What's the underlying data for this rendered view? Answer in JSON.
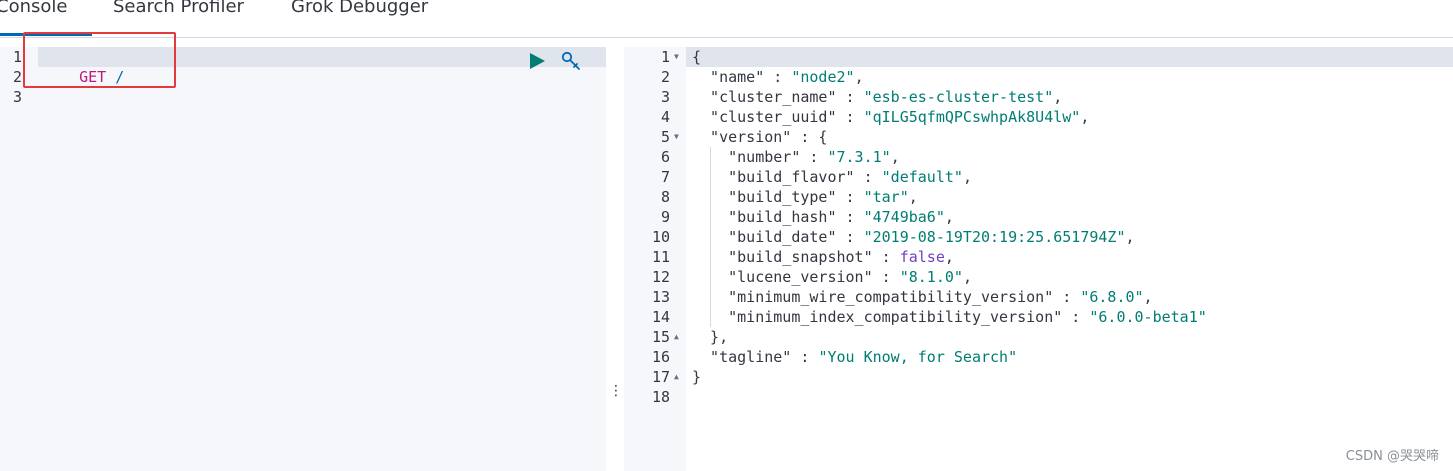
{
  "tabs": [
    {
      "label": "Console"
    },
    {
      "label": "Search Profiler"
    },
    {
      "label": "Grok Debugger"
    }
  ],
  "request_editor": {
    "line_numbers": [
      "1",
      "2",
      "3"
    ],
    "method": "GET",
    "path": "/"
  },
  "response": {
    "line_numbers": [
      "1",
      "2",
      "3",
      "4",
      "5",
      "6",
      "7",
      "8",
      "9",
      "10",
      "11",
      "12",
      "13",
      "14",
      "15",
      "16",
      "17",
      "18"
    ],
    "lines": [
      [
        {
          "c": "punc",
          "t": "{"
        }
      ],
      [
        {
          "c": "key",
          "t": "  \"name\""
        },
        {
          "c": "punc",
          "t": " : "
        },
        {
          "c": "str",
          "t": "\"node2\""
        },
        {
          "c": "punc",
          "t": ","
        }
      ],
      [
        {
          "c": "key",
          "t": "  \"cluster_name\""
        },
        {
          "c": "punc",
          "t": " : "
        },
        {
          "c": "str",
          "t": "\"esb-es-cluster-test\""
        },
        {
          "c": "punc",
          "t": ","
        }
      ],
      [
        {
          "c": "key",
          "t": "  \"cluster_uuid\""
        },
        {
          "c": "punc",
          "t": " : "
        },
        {
          "c": "str",
          "t": "\"qILG5qfmQPCswhpAk8U4lw\""
        },
        {
          "c": "punc",
          "t": ","
        }
      ],
      [
        {
          "c": "key",
          "t": "  \"version\""
        },
        {
          "c": "punc",
          "t": " : {"
        }
      ],
      [
        {
          "c": "key",
          "t": "    \"number\""
        },
        {
          "c": "punc",
          "t": " : "
        },
        {
          "c": "str",
          "t": "\"7.3.1\""
        },
        {
          "c": "punc",
          "t": ","
        }
      ],
      [
        {
          "c": "key",
          "t": "    \"build_flavor\""
        },
        {
          "c": "punc",
          "t": " : "
        },
        {
          "c": "str",
          "t": "\"default\""
        },
        {
          "c": "punc",
          "t": ","
        }
      ],
      [
        {
          "c": "key",
          "t": "    \"build_type\""
        },
        {
          "c": "punc",
          "t": " : "
        },
        {
          "c": "str",
          "t": "\"tar\""
        },
        {
          "c": "punc",
          "t": ","
        }
      ],
      [
        {
          "c": "key",
          "t": "    \"build_hash\""
        },
        {
          "c": "punc",
          "t": " : "
        },
        {
          "c": "str",
          "t": "\"4749ba6\""
        },
        {
          "c": "punc",
          "t": ","
        }
      ],
      [
        {
          "c": "key",
          "t": "    \"build_date\""
        },
        {
          "c": "punc",
          "t": " : "
        },
        {
          "c": "str",
          "t": "\"2019-08-19T20:19:25.651794Z\""
        },
        {
          "c": "punc",
          "t": ","
        }
      ],
      [
        {
          "c": "key",
          "t": "    \"build_snapshot\""
        },
        {
          "c": "punc",
          "t": " : "
        },
        {
          "c": "bool",
          "t": "false"
        },
        {
          "c": "punc",
          "t": ","
        }
      ],
      [
        {
          "c": "key",
          "t": "    \"lucene_version\""
        },
        {
          "c": "punc",
          "t": " : "
        },
        {
          "c": "str",
          "t": "\"8.1.0\""
        },
        {
          "c": "punc",
          "t": ","
        }
      ],
      [
        {
          "c": "key",
          "t": "    \"minimum_wire_compatibility_version\""
        },
        {
          "c": "punc",
          "t": " : "
        },
        {
          "c": "str",
          "t": "\"6.8.0\""
        },
        {
          "c": "punc",
          "t": ","
        }
      ],
      [
        {
          "c": "key",
          "t": "    \"minimum_index_compatibility_version\""
        },
        {
          "c": "punc",
          "t": " : "
        },
        {
          "c": "str",
          "t": "\"6.0.0-beta1\""
        }
      ],
      [
        {
          "c": "punc",
          "t": "  },"
        }
      ],
      [
        {
          "c": "key",
          "t": "  \"tagline\""
        },
        {
          "c": "punc",
          "t": " : "
        },
        {
          "c": "str",
          "t": "\"You Know, for Search\""
        }
      ],
      [
        {
          "c": "punc",
          "t": "}"
        }
      ],
      []
    ],
    "fold_markers": {
      "0": "down",
      "4": "down",
      "14": "up",
      "16": "up"
    }
  },
  "watermark": "CSDN @哭哭啼",
  "colors": {
    "accent": "#006bb4",
    "run": "#017d73",
    "method": "#bc1a7a",
    "string": "#017d73",
    "annotation_box": "#e23b3b"
  },
  "icons": {
    "run": "play-icon",
    "settings": "wrench-icon",
    "fold": "caret-icon",
    "divider": "vertical-ellipsis-icon"
  }
}
